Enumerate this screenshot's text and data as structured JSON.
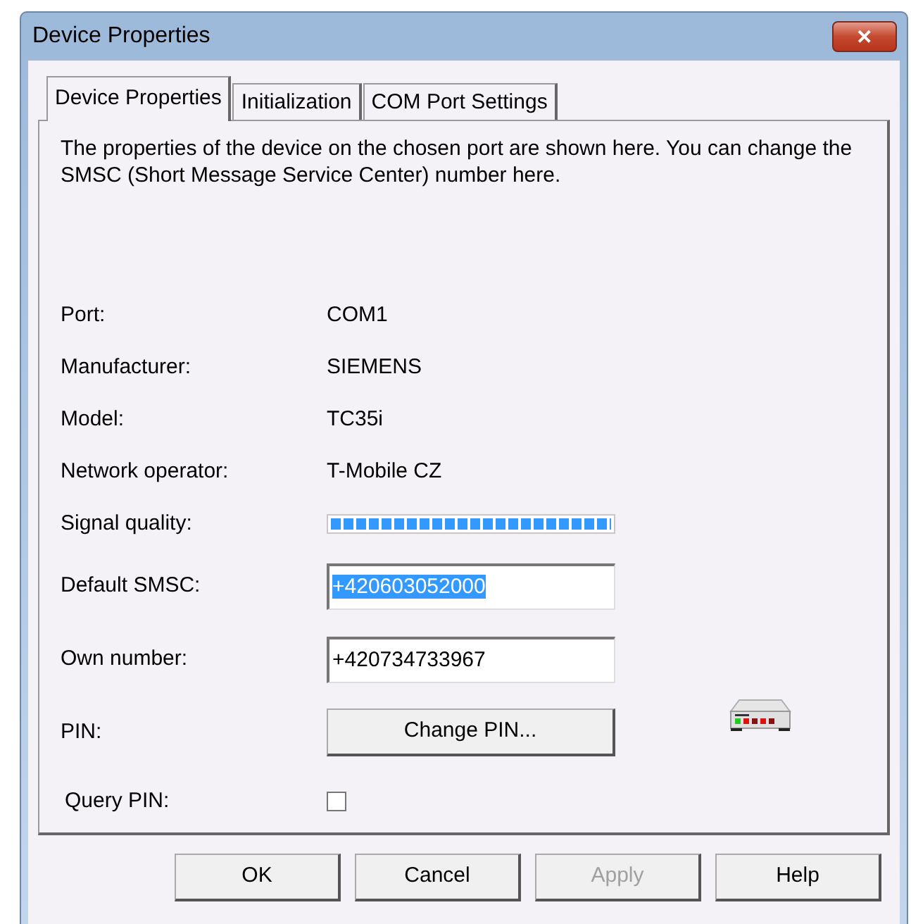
{
  "window": {
    "title": "Device Properties",
    "close": "✕"
  },
  "tabs": [
    {
      "label": "Device Properties",
      "selected": true
    },
    {
      "label": "Initialization",
      "selected": false
    },
    {
      "label": "COM Port Settings",
      "selected": false
    }
  ],
  "description": "The properties of the device on the chosen port are shown here. You can change the SMSC (Short Message Service Center) number here.",
  "rows": [
    {
      "kind": "text",
      "label": "Port:",
      "value": "COM1"
    },
    {
      "kind": "text",
      "label": "Manufacturer:",
      "value": "SIEMENS"
    },
    {
      "kind": "text",
      "label": "Model:",
      "value": "TC35i"
    },
    {
      "kind": "text",
      "label": "Network operator:",
      "value": "T-Mobile CZ"
    },
    {
      "kind": "meter",
      "label": "Signal quality:",
      "level": 1
    },
    {
      "kind": "field",
      "label": "Default SMSC:",
      "value": "+420603052000",
      "selected": true
    },
    {
      "kind": "field",
      "label": "Own number:",
      "value": "+420734733967",
      "selected": false
    },
    {
      "kind": "button",
      "label": "PIN:",
      "button": "Change PIN..."
    },
    {
      "kind": "checkbox",
      "label": "Query PIN:",
      "checked": false
    }
  ],
  "buttons": [
    {
      "label": "OK",
      "disabled": false
    },
    {
      "label": "Cancel",
      "disabled": false
    },
    {
      "label": "Apply",
      "disabled": true
    },
    {
      "label": "Help",
      "disabled": false
    }
  ]
}
